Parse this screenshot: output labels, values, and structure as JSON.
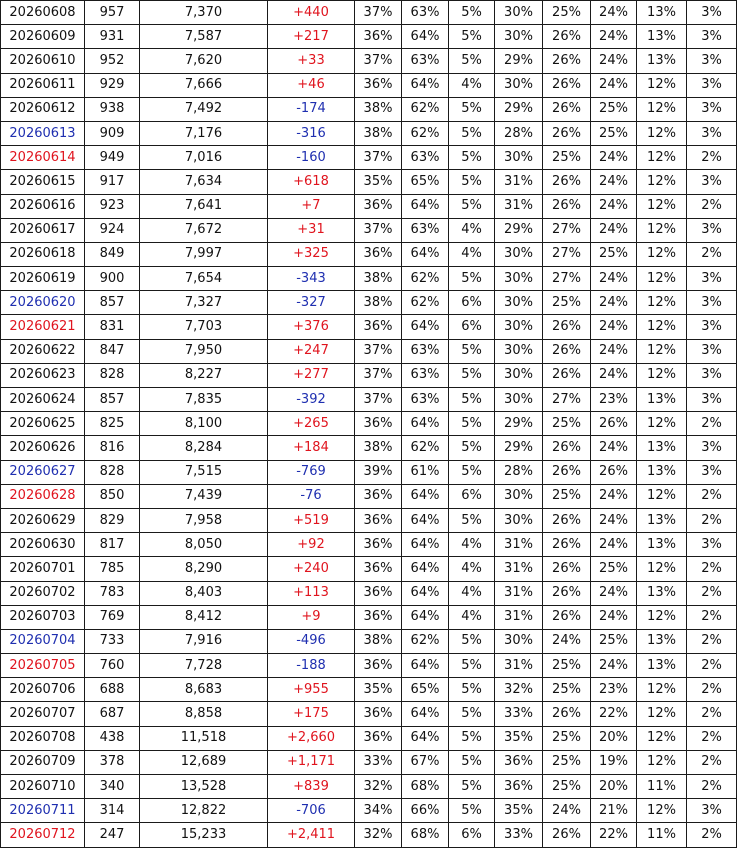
{
  "colors": {
    "weekday": "#111111",
    "saturday": "#1f2fb0",
    "sunday": "#e0141e",
    "positive_change": "#e0141e",
    "negative_change": "#1f2fb0"
  },
  "rows": [
    {
      "date": "20260608",
      "date_color": "black",
      "c1": "957",
      "c2": "7,370",
      "change": "+440",
      "p1": "37%",
      "p2": "63%",
      "p3": "5%",
      "p4": "30%",
      "p5": "25%",
      "p6": "24%",
      "p7": "13%",
      "p8": "3%"
    },
    {
      "date": "20260609",
      "date_color": "black",
      "c1": "931",
      "c2": "7,587",
      "change": "+217",
      "p1": "36%",
      "p2": "64%",
      "p3": "5%",
      "p4": "30%",
      "p5": "26%",
      "p6": "24%",
      "p7": "13%",
      "p8": "3%"
    },
    {
      "date": "20260610",
      "date_color": "black",
      "c1": "952",
      "c2": "7,620",
      "change": "+33",
      "p1": "37%",
      "p2": "63%",
      "p3": "5%",
      "p4": "29%",
      "p5": "26%",
      "p6": "24%",
      "p7": "13%",
      "p8": "3%"
    },
    {
      "date": "20260611",
      "date_color": "black",
      "c1": "929",
      "c2": "7,666",
      "change": "+46",
      "p1": "36%",
      "p2": "64%",
      "p3": "4%",
      "p4": "30%",
      "p5": "26%",
      "p6": "24%",
      "p7": "12%",
      "p8": "3%"
    },
    {
      "date": "20260612",
      "date_color": "black",
      "c1": "938",
      "c2": "7,492",
      "change": "-174",
      "p1": "38%",
      "p2": "62%",
      "p3": "5%",
      "p4": "29%",
      "p5": "26%",
      "p6": "25%",
      "p7": "12%",
      "p8": "3%"
    },
    {
      "date": "20260613",
      "date_color": "blue",
      "c1": "909",
      "c2": "7,176",
      "change": "-316",
      "p1": "38%",
      "p2": "62%",
      "p3": "5%",
      "p4": "28%",
      "p5": "26%",
      "p6": "25%",
      "p7": "12%",
      "p8": "3%"
    },
    {
      "date": "20260614",
      "date_color": "red",
      "c1": "949",
      "c2": "7,016",
      "change": "-160",
      "p1": "37%",
      "p2": "63%",
      "p3": "5%",
      "p4": "30%",
      "p5": "25%",
      "p6": "24%",
      "p7": "12%",
      "p8": "2%"
    },
    {
      "date": "20260615",
      "date_color": "black",
      "c1": "917",
      "c2": "7,634",
      "change": "+618",
      "p1": "35%",
      "p2": "65%",
      "p3": "5%",
      "p4": "31%",
      "p5": "26%",
      "p6": "24%",
      "p7": "12%",
      "p8": "3%"
    },
    {
      "date": "20260616",
      "date_color": "black",
      "c1": "923",
      "c2": "7,641",
      "change": "+7",
      "p1": "36%",
      "p2": "64%",
      "p3": "5%",
      "p4": "31%",
      "p5": "26%",
      "p6": "24%",
      "p7": "12%",
      "p8": "2%"
    },
    {
      "date": "20260617",
      "date_color": "black",
      "c1": "924",
      "c2": "7,672",
      "change": "+31",
      "p1": "37%",
      "p2": "63%",
      "p3": "4%",
      "p4": "29%",
      "p5": "27%",
      "p6": "24%",
      "p7": "12%",
      "p8": "3%"
    },
    {
      "date": "20260618",
      "date_color": "black",
      "c1": "849",
      "c2": "7,997",
      "change": "+325",
      "p1": "36%",
      "p2": "64%",
      "p3": "4%",
      "p4": "30%",
      "p5": "27%",
      "p6": "25%",
      "p7": "12%",
      "p8": "2%"
    },
    {
      "date": "20260619",
      "date_color": "black",
      "c1": "900",
      "c2": "7,654",
      "change": "-343",
      "p1": "38%",
      "p2": "62%",
      "p3": "5%",
      "p4": "30%",
      "p5": "27%",
      "p6": "24%",
      "p7": "12%",
      "p8": "3%"
    },
    {
      "date": "20260620",
      "date_color": "blue",
      "c1": "857",
      "c2": "7,327",
      "change": "-327",
      "p1": "38%",
      "p2": "62%",
      "p3": "6%",
      "p4": "30%",
      "p5": "25%",
      "p6": "24%",
      "p7": "12%",
      "p8": "3%"
    },
    {
      "date": "20260621",
      "date_color": "red",
      "c1": "831",
      "c2": "7,703",
      "change": "+376",
      "p1": "36%",
      "p2": "64%",
      "p3": "6%",
      "p4": "30%",
      "p5": "26%",
      "p6": "24%",
      "p7": "12%",
      "p8": "3%"
    },
    {
      "date": "20260622",
      "date_color": "black",
      "c1": "847",
      "c2": "7,950",
      "change": "+247",
      "p1": "37%",
      "p2": "63%",
      "p3": "5%",
      "p4": "30%",
      "p5": "26%",
      "p6": "24%",
      "p7": "12%",
      "p8": "3%"
    },
    {
      "date": "20260623",
      "date_color": "black",
      "c1": "828",
      "c2": "8,227",
      "change": "+277",
      "p1": "37%",
      "p2": "63%",
      "p3": "5%",
      "p4": "30%",
      "p5": "26%",
      "p6": "24%",
      "p7": "12%",
      "p8": "3%"
    },
    {
      "date": "20260624",
      "date_color": "black",
      "c1": "857",
      "c2": "7,835",
      "change": "-392",
      "p1": "37%",
      "p2": "63%",
      "p3": "5%",
      "p4": "30%",
      "p5": "27%",
      "p6": "23%",
      "p7": "13%",
      "p8": "3%"
    },
    {
      "date": "20260625",
      "date_color": "black",
      "c1": "825",
      "c2": "8,100",
      "change": "+265",
      "p1": "36%",
      "p2": "64%",
      "p3": "5%",
      "p4": "29%",
      "p5": "25%",
      "p6": "26%",
      "p7": "12%",
      "p8": "2%"
    },
    {
      "date": "20260626",
      "date_color": "black",
      "c1": "816",
      "c2": "8,284",
      "change": "+184",
      "p1": "38%",
      "p2": "62%",
      "p3": "5%",
      "p4": "29%",
      "p5": "26%",
      "p6": "24%",
      "p7": "13%",
      "p8": "3%"
    },
    {
      "date": "20260627",
      "date_color": "blue",
      "c1": "828",
      "c2": "7,515",
      "change": "-769",
      "p1": "39%",
      "p2": "61%",
      "p3": "5%",
      "p4": "28%",
      "p5": "26%",
      "p6": "26%",
      "p7": "13%",
      "p8": "3%"
    },
    {
      "date": "20260628",
      "date_color": "red",
      "c1": "850",
      "c2": "7,439",
      "change": "-76",
      "p1": "36%",
      "p2": "64%",
      "p3": "6%",
      "p4": "30%",
      "p5": "25%",
      "p6": "24%",
      "p7": "12%",
      "p8": "2%"
    },
    {
      "date": "20260629",
      "date_color": "black",
      "c1": "829",
      "c2": "7,958",
      "change": "+519",
      "p1": "36%",
      "p2": "64%",
      "p3": "5%",
      "p4": "30%",
      "p5": "26%",
      "p6": "24%",
      "p7": "13%",
      "p8": "2%"
    },
    {
      "date": "20260630",
      "date_color": "black",
      "c1": "817",
      "c2": "8,050",
      "change": "+92",
      "p1": "36%",
      "p2": "64%",
      "p3": "4%",
      "p4": "31%",
      "p5": "26%",
      "p6": "24%",
      "p7": "13%",
      "p8": "3%"
    },
    {
      "date": "20260701",
      "date_color": "black",
      "c1": "785",
      "c2": "8,290",
      "change": "+240",
      "p1": "36%",
      "p2": "64%",
      "p3": "4%",
      "p4": "31%",
      "p5": "26%",
      "p6": "25%",
      "p7": "12%",
      "p8": "2%"
    },
    {
      "date": "20260702",
      "date_color": "black",
      "c1": "783",
      "c2": "8,403",
      "change": "+113",
      "p1": "36%",
      "p2": "64%",
      "p3": "4%",
      "p4": "31%",
      "p5": "26%",
      "p6": "24%",
      "p7": "13%",
      "p8": "2%"
    },
    {
      "date": "20260703",
      "date_color": "black",
      "c1": "769",
      "c2": "8,412",
      "change": "+9",
      "p1": "36%",
      "p2": "64%",
      "p3": "4%",
      "p4": "31%",
      "p5": "26%",
      "p6": "24%",
      "p7": "12%",
      "p8": "2%"
    },
    {
      "date": "20260704",
      "date_color": "blue",
      "c1": "733",
      "c2": "7,916",
      "change": "-496",
      "p1": "38%",
      "p2": "62%",
      "p3": "5%",
      "p4": "30%",
      "p5": "24%",
      "p6": "25%",
      "p7": "13%",
      "p8": "2%"
    },
    {
      "date": "20260705",
      "date_color": "red",
      "c1": "760",
      "c2": "7,728",
      "change": "-188",
      "p1": "36%",
      "p2": "64%",
      "p3": "5%",
      "p4": "31%",
      "p5": "25%",
      "p6": "24%",
      "p7": "13%",
      "p8": "2%"
    },
    {
      "date": "20260706",
      "date_color": "black",
      "c1": "688",
      "c2": "8,683",
      "change": "+955",
      "p1": "35%",
      "p2": "65%",
      "p3": "5%",
      "p4": "32%",
      "p5": "25%",
      "p6": "23%",
      "p7": "12%",
      "p8": "2%"
    },
    {
      "date": "20260707",
      "date_color": "black",
      "c1": "687",
      "c2": "8,858",
      "change": "+175",
      "p1": "36%",
      "p2": "64%",
      "p3": "5%",
      "p4": "33%",
      "p5": "26%",
      "p6": "22%",
      "p7": "12%",
      "p8": "2%"
    },
    {
      "date": "20260708",
      "date_color": "black",
      "c1": "438",
      "c2": "11,518",
      "change": "+2,660",
      "p1": "36%",
      "p2": "64%",
      "p3": "5%",
      "p4": "35%",
      "p5": "25%",
      "p6": "20%",
      "p7": "12%",
      "p8": "2%"
    },
    {
      "date": "20260709",
      "date_color": "black",
      "c1": "378",
      "c2": "12,689",
      "change": "+1,171",
      "p1": "33%",
      "p2": "67%",
      "p3": "5%",
      "p4": "36%",
      "p5": "25%",
      "p6": "19%",
      "p7": "12%",
      "p8": "2%"
    },
    {
      "date": "20260710",
      "date_color": "black",
      "c1": "340",
      "c2": "13,528",
      "change": "+839",
      "p1": "32%",
      "p2": "68%",
      "p3": "5%",
      "p4": "36%",
      "p5": "25%",
      "p6": "20%",
      "p7": "11%",
      "p8": "2%"
    },
    {
      "date": "20260711",
      "date_color": "blue",
      "c1": "314",
      "c2": "12,822",
      "change": "-706",
      "p1": "34%",
      "p2": "66%",
      "p3": "5%",
      "p4": "35%",
      "p5": "24%",
      "p6": "21%",
      "p7": "12%",
      "p8": "3%"
    },
    {
      "date": "20260712",
      "date_color": "red",
      "c1": "247",
      "c2": "15,233",
      "change": "+2,411",
      "p1": "32%",
      "p2": "68%",
      "p3": "6%",
      "p4": "33%",
      "p5": "26%",
      "p6": "22%",
      "p7": "11%",
      "p8": "2%"
    }
  ]
}
